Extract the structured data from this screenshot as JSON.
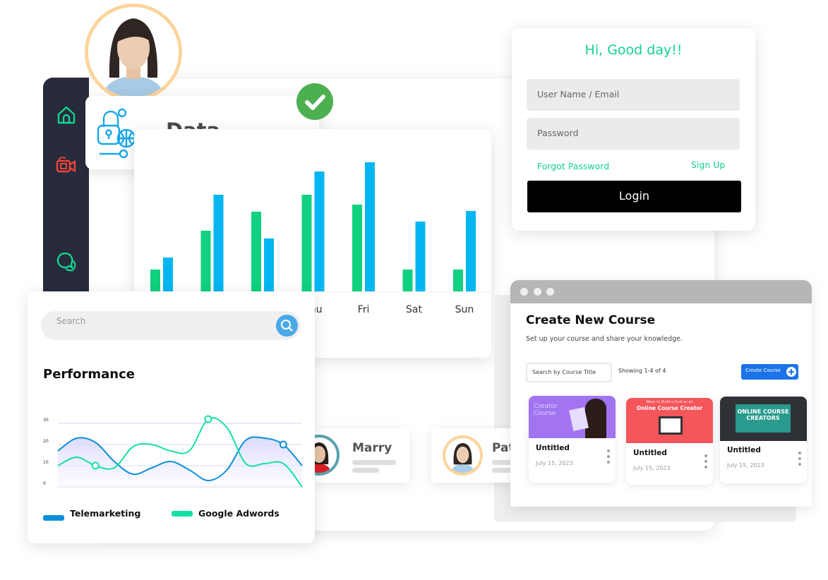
{
  "sidebar": {
    "items": [
      {
        "icon": "home-icon",
        "color": "#13d38e"
      },
      {
        "icon": "video-camera-icon",
        "color": "#f0433a"
      },
      {
        "icon": "chat-icon",
        "color": "#13d38e"
      }
    ]
  },
  "security_card": {
    "title": "Data Security",
    "icon": "data-security-lock-globe-icon",
    "badge_icon": "check-icon",
    "badge_color": "#4caf50"
  },
  "bar_chart_data": {
    "type": "bar",
    "categories": [
      "",
      "",
      "",
      "Thu",
      "Fri",
      "Sat",
      "Sun"
    ],
    "series": [
      {
        "color": "#0fd17f",
        "values": [
          31,
          86,
          113,
          137,
          123,
          31,
          31
        ]
      },
      {
        "color": "#03b6f1",
        "values": [
          48,
          137,
          75,
          170,
          183,
          99,
          114
        ]
      }
    ]
  },
  "performance": {
    "search_placeholder": "Search",
    "title": "Performance",
    "chart_data": {
      "type": "line",
      "yticks": [
        "30",
        "20",
        "10",
        "0"
      ],
      "ylim": [
        0,
        30
      ],
      "grid": true,
      "legend_placement": "bottom",
      "series": [
        {
          "name": "Telemarketing",
          "color": "#0b8fd8",
          "values": [
            17,
            23,
            21,
            12,
            6,
            9,
            12,
            8,
            3,
            8,
            22,
            23,
            20,
            10
          ],
          "markers": [
            12
          ]
        },
        {
          "name": "Google Adwords",
          "color": "#13e0a5",
          "values": [
            10,
            14,
            10,
            9,
            19,
            20,
            17,
            17,
            32,
            28,
            11,
            11,
            11,
            0
          ],
          "markers": [
            2,
            8
          ]
        }
      ]
    }
  },
  "people": [
    {
      "name": "Marry",
      "ring": "#5aa3ad"
    },
    {
      "name": "Pat",
      "ring": "#fcd49b"
    }
  ],
  "course": {
    "title": "Create New Course",
    "subtitle": "Set up your course and share your knowledge.",
    "search_placeholder": "Search by Course Title",
    "showing": "Showing 1-4 of 4",
    "create_label": "Create Course",
    "accent": "#1a73e8",
    "cards": [
      {
        "title": "Untitled",
        "date": "July 15, 2023",
        "thumb_text": "Creator Course",
        "thumb_color": "#a274f2"
      },
      {
        "title": "Untitled",
        "date": "July 15, 2023",
        "thumb_text": "Online Course Creator",
        "thumb_sub": "Ways to Build a Quiz as an",
        "thumb_color": "#f4565b"
      },
      {
        "title": "Untitled",
        "date": "July 15, 2023",
        "thumb_text": "ONLINE COURSE CREATORS",
        "thumb_color": "#2e3236"
      }
    ]
  },
  "login": {
    "greeting": "Hi, Good day!!",
    "username_placeholder": "User Name / Email",
    "password_placeholder": "Password",
    "forgot": "Forgot Password",
    "signup": "Sign Up",
    "button": "Login",
    "accent": "#13d38e"
  }
}
